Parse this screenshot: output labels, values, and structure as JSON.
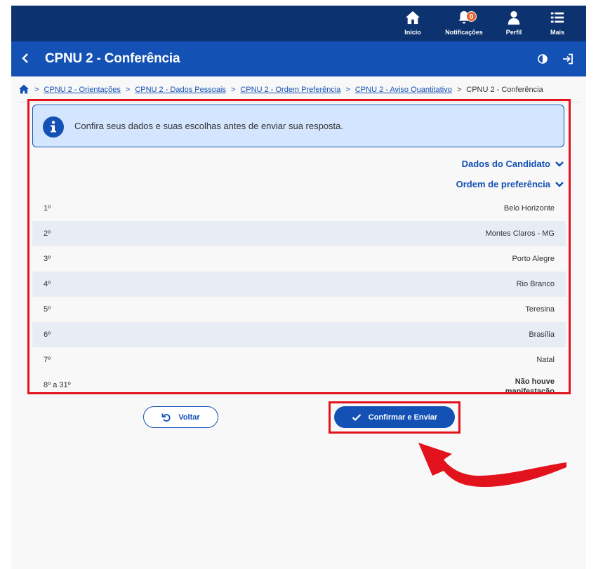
{
  "topnav": {
    "items": [
      {
        "label": "Início",
        "icon": "home-icon"
      },
      {
        "label": "Notificações",
        "icon": "bell-icon",
        "badge": "0"
      },
      {
        "label": "Perfil",
        "icon": "user-icon"
      },
      {
        "label": "Mais",
        "icon": "list-icon"
      }
    ]
  },
  "header": {
    "title": "CPNU 2 - Conferência"
  },
  "breadcrumb": {
    "items": [
      "CPNU 2 - Orientações",
      "CPNU 2 - Dados Pessoais",
      "CPNU 2 - Ordem Preferência",
      "CPNU 2 - Aviso Quantitativo"
    ],
    "current": "CPNU 2 - Conferência"
  },
  "alert": {
    "message": "Confira seus dados e suas escolhas antes de enviar sua resposta."
  },
  "sections": {
    "candidate": "Dados do Candidato",
    "preference": "Ordem de preferência"
  },
  "preferences": [
    {
      "pos": "1º",
      "city": "Belo Horizonte"
    },
    {
      "pos": "2º",
      "city": "Montes Claros - MG"
    },
    {
      "pos": "3º",
      "city": "Porto Alegre"
    },
    {
      "pos": "4º",
      "city": "Rio Branco"
    },
    {
      "pos": "5º",
      "city": "Teresina"
    },
    {
      "pos": "6º",
      "city": "Brasília"
    },
    {
      "pos": "7º",
      "city": "Natal"
    },
    {
      "pos": "8º a 31º",
      "city_line1": "Não houve",
      "city_line2": "manifestação"
    }
  ],
  "buttons": {
    "back": "Voltar",
    "confirm": "Confirmar e Enviar"
  },
  "colors": {
    "navy": "#0c326f",
    "primary": "#1351b4",
    "alert_bg": "#d4e5ff",
    "row_alt": "#e8edf5",
    "highlight_red": "#e3131d",
    "badge": "#e5622d"
  }
}
